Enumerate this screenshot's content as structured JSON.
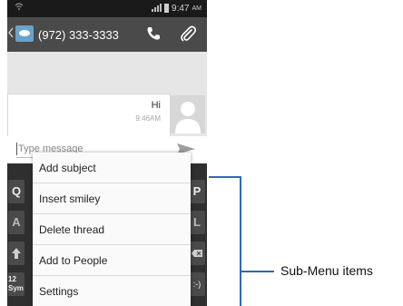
{
  "status_bar": {
    "time": "9:47",
    "ampm": "AM",
    "signal_icon": "wifi-icon",
    "bars_icon": "signal-bars-icon",
    "battery_icon": "battery-icon"
  },
  "action_bar": {
    "phone_number": "(972) 333-3333",
    "back_icon": "back-chevron-icon",
    "contact_icon": "contact-avatar-icon",
    "call_icon": "phone-icon",
    "attach_icon": "paperclip-icon"
  },
  "thread": {
    "message_text": "Hi",
    "message_time": "9:46AM"
  },
  "compose": {
    "placeholder": "Type message",
    "send_icon": "send-icon"
  },
  "keyboard": {
    "visible_keys": [
      "Q",
      "P",
      "A",
      "L",
      "12",
      "Sym",
      ":-)"
    ]
  },
  "submenu": {
    "items": [
      "Add subject",
      "Insert smiley",
      "Delete thread",
      "Add to People",
      "Settings"
    ]
  },
  "annotation": {
    "label": "Sub-Menu items",
    "line_color": "#2a6cb3"
  }
}
